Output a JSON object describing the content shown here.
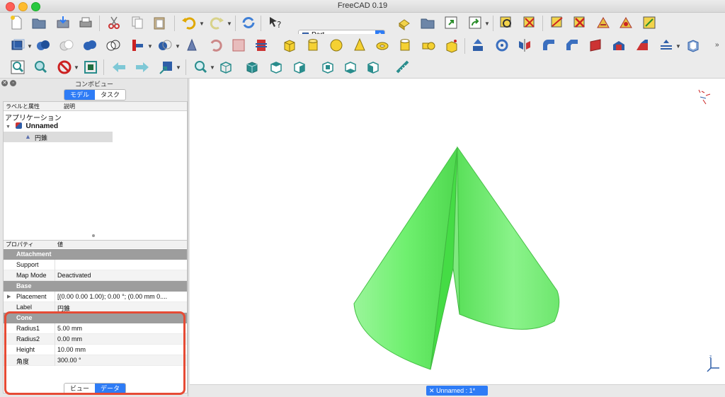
{
  "window": {
    "title": "FreeCAD 0.19"
  },
  "toolbar": {
    "row1": [
      "new-document-icon",
      "open-folder-icon",
      "save-icon",
      "print-icon",
      "cut-icon",
      "copy-icon",
      "paste-icon",
      "undo-icon",
      "redo-icon",
      "refresh-icon",
      "whats-this-icon",
      "part-design-icon",
      "open-group-icon",
      "macro-record-icon",
      "macro-execute-icon",
      "macro-edit-icon",
      "measure-linear-icon",
      "measure-angular-icon",
      "measure-refresh-icon",
      "measure-clear-icon",
      "measure-toggle-icon",
      "measure-3d-icon"
    ],
    "workbench": {
      "selected": "Part"
    }
  },
  "combo": {
    "title": "コンボビュー",
    "tabs": [
      {
        "label": "モデル",
        "active": true
      },
      {
        "label": "タスク",
        "active": false
      }
    ]
  },
  "tree": {
    "columns": [
      "ラベルと属性",
      "説明"
    ],
    "root": "アプリケーション",
    "document": "Unnamed",
    "child": "円錐"
  },
  "properties": {
    "columns": [
      "プロパティ",
      "値"
    ],
    "groups": [
      {
        "name": "Attachment",
        "rows": [
          {
            "name": "Support",
            "value": ""
          },
          {
            "name": "Map Mode",
            "value": "Deactivated"
          }
        ]
      },
      {
        "name": "Base",
        "rows": [
          {
            "name": "Placement",
            "value": "[(0.00 0.00 1.00); 0.00 °; (0.00 mm  0...."
          },
          {
            "name": "Label",
            "value": "円錐"
          }
        ]
      },
      {
        "name": "Cone",
        "rows": [
          {
            "name": "Radius1",
            "value": "5.00 mm"
          },
          {
            "name": "Radius2",
            "value": "0.00 mm"
          },
          {
            "name": "Height",
            "value": "10.00 mm"
          },
          {
            "name": "角度",
            "value": "300.00 °"
          }
        ]
      }
    ],
    "view_tabs": [
      {
        "label": "ビュー",
        "active": false
      },
      {
        "label": "データ",
        "active": true
      }
    ]
  },
  "viewport": {
    "tab_label": "Unnamed : 1*",
    "tab_close": "✕"
  },
  "colors": {
    "accent": "#2e7cf6",
    "highlight": "#e64b35",
    "cone": "#5ee95e"
  }
}
